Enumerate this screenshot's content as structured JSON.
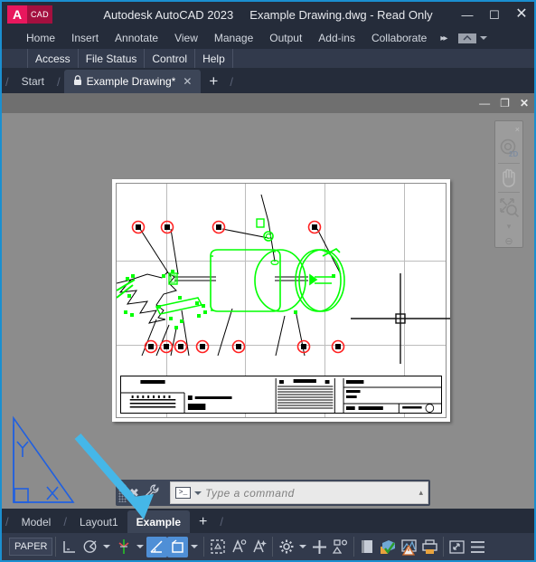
{
  "window": {
    "app_title": "Autodesk AutoCAD 2023",
    "document_title": "Example Drawing.dwg - Read Only",
    "logo_a": "A",
    "logo_cad": "CAD",
    "controls": {
      "minimize": "minimize-icon",
      "maximize": "maximize-icon",
      "close": "close-icon"
    }
  },
  "ribbon": {
    "tabs": [
      "Home",
      "Insert",
      "Annotate",
      "View",
      "Manage",
      "Output",
      "Add-ins",
      "Collaborate"
    ],
    "overflow": "▸▸",
    "minimize_ribbon": "ribbon-minimize-icon"
  },
  "submenu": {
    "items": [
      "Access",
      "File Status",
      "Control",
      "Help"
    ]
  },
  "file_tabs": {
    "items": [
      {
        "label": "Start",
        "active": false,
        "locked": false,
        "closable": false
      },
      {
        "label": "Example Drawing*",
        "active": true,
        "locked": true,
        "closable": true
      }
    ],
    "close_glyph": "✕",
    "lock_glyph": "🔒",
    "new_tab": "+"
  },
  "document_window": {
    "controls": {
      "minimize": "minimize-icon",
      "restore": "restore-icon",
      "close": "close-icon"
    }
  },
  "navbar": {
    "close_glyph": "×",
    "items": [
      {
        "name": "steering-wheel-2d-icon",
        "label": "2D"
      },
      {
        "name": "pan-hand-icon",
        "label": ""
      },
      {
        "name": "zoom-extents-icon",
        "label": ""
      }
    ],
    "expand_caret": "▾",
    "minimize_glyph": "⊖"
  },
  "drawing": {
    "paper_color": "#ffffff",
    "geometry_color": "#00ff00",
    "leader_color": "#000000",
    "balloon_edge_color": "#ff2020",
    "background_color": "#8c8c8c"
  },
  "command_line": {
    "placeholder": "Type a command",
    "value": "",
    "prompt_glyph": "▶_",
    "dropdown_caret": "▾",
    "expand_caret": "▴",
    "tools": [
      "customize-icon",
      "wrench-icon"
    ]
  },
  "layout_tabs": {
    "items": [
      {
        "label": "Model",
        "active": false
      },
      {
        "label": "Layout1",
        "active": false
      },
      {
        "label": "Example",
        "active": true
      }
    ],
    "new_layout": "+"
  },
  "status_bar": {
    "space_label": "PAPER",
    "items": [
      {
        "name": "grid-display-icon",
        "active": false,
        "has_caret": false
      },
      {
        "name": "snap-mode-icon",
        "active": false,
        "has_caret": true
      },
      {
        "name": "ortho-polar-tracking-icon",
        "active": false,
        "has_caret": true
      },
      {
        "name": "object-snap-tracking-icon",
        "active": true,
        "has_caret": false
      },
      {
        "name": "object-snap-icon",
        "active": true,
        "has_caret": true
      },
      {
        "name": "selection-cycling-icon",
        "active": false,
        "has_caret": false
      },
      {
        "name": "annotation-visibility-icon",
        "active": false,
        "has_caret": false
      },
      {
        "name": "auto-scale-annotation-icon",
        "active": false,
        "has_caret": false
      },
      {
        "name": "annotation-scale-gear-icon",
        "active": false,
        "has_caret": true
      },
      {
        "name": "isolate-objects-icon",
        "active": false,
        "has_caret": false
      },
      {
        "name": "workspace-switching-icon",
        "active": false,
        "has_caret": false
      },
      {
        "name": "viewport-lock-icon",
        "active": false,
        "has_caret": false
      },
      {
        "name": "hardware-acceleration-icon",
        "active": false,
        "has_caret": false
      },
      {
        "name": "performance-warning-icon",
        "active": false,
        "has_caret": false
      },
      {
        "name": "plot-print-icon",
        "active": false,
        "has_caret": false
      },
      {
        "name": "clean-screen-icon",
        "active": false,
        "has_caret": false
      },
      {
        "name": "customization-menu-icon",
        "active": false,
        "has_caret": false
      }
    ]
  },
  "annotations": {
    "arrow": {
      "name": "pointer-arrow",
      "color": "#45b7e8",
      "target": "Example"
    },
    "triangle": {
      "name": "triangle-sketch",
      "color": "#2060e0"
    }
  }
}
